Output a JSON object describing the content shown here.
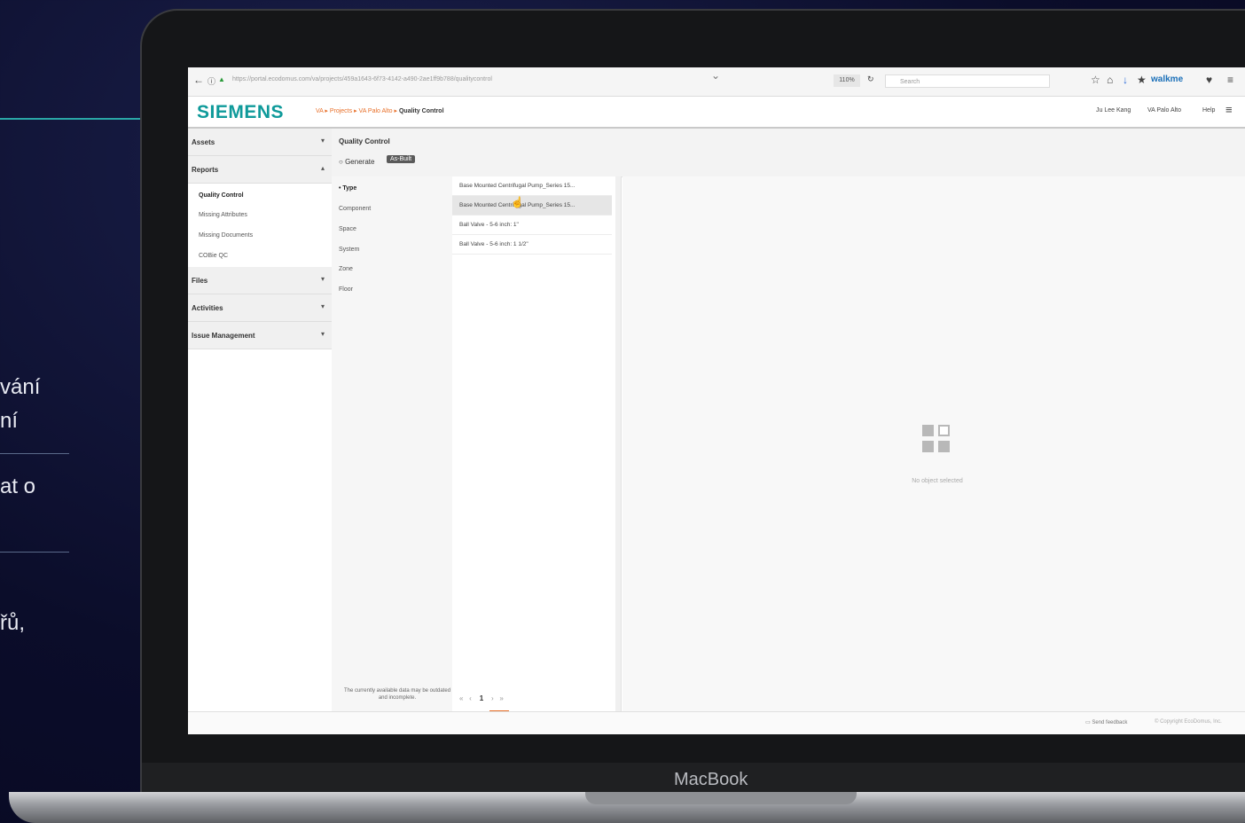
{
  "slide": {
    "lines": [
      "vání",
      "ní",
      "at o",
      "řů,"
    ]
  },
  "laptop": {
    "brand": "MacBook"
  },
  "browser": {
    "url": "https://portal.ecodomus.com/va/projects/459a1643-6f73-4142-a490-2ae1ff9b788/qualitycontrol",
    "zoom": "110%",
    "search_placeholder": "Search",
    "walkme": "walkme"
  },
  "app": {
    "logo": "SIEMENS",
    "breadcrumb": [
      "VA",
      "Projects",
      "VA Palo Alto",
      "Quality Control"
    ],
    "user": "Ju Lee Kang",
    "project": "VA Palo Alto",
    "help": "Help"
  },
  "sidebar": {
    "groups": [
      {
        "label": "Assets"
      },
      {
        "label": "Reports"
      },
      {
        "label": "Files"
      },
      {
        "label": "Activities"
      },
      {
        "label": "Issue Management"
      }
    ],
    "report_items": [
      "Quality Control",
      "Missing Attributes",
      "Missing Documents",
      "COBie QC"
    ]
  },
  "content": {
    "title": "Quality Control",
    "generate": "Generate",
    "badge": "As-Built"
  },
  "filters": [
    "Type",
    "Component",
    "Space",
    "System",
    "Zone",
    "Floor"
  ],
  "note": "The currently available data may be outdated and incomplete.",
  "results": [
    "Base Mounted Centrifugal Pump_Series 15...",
    "Base Mounted Centrifugal Pump_Series 15...",
    "Ball Valve - 5-6 inch: 1\"",
    "Ball Valve - 5-6 inch: 1 1/2\""
  ],
  "pager": {
    "first": "«",
    "prev": "‹",
    "current": "1",
    "next": "›",
    "last": "»"
  },
  "detail": {
    "empty_text": "No object selected"
  },
  "footer": {
    "feedback": "Send feedback",
    "copyright": "© Copyright EcoDomus, Inc."
  }
}
